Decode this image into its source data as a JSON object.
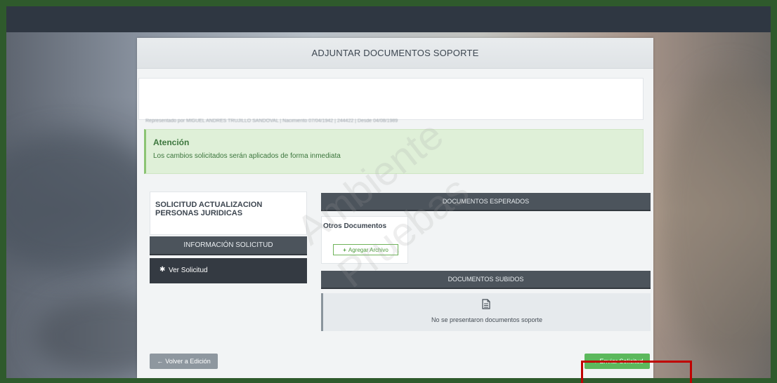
{
  "panel": {
    "title": "ADJUNTAR DOCUMENTOS SOPORTE"
  },
  "applicant": {
    "partial_info": "Representado por MIGUEL ANDRES TRUJILLO SANDOVAL | Nacimiento 07/04/1942 | 244422 | Desde 04/08/1989"
  },
  "alert": {
    "title": "Atención",
    "text": "Los cambios solicitados serán aplicados de forma inmediata"
  },
  "request": {
    "title": "SOLICITUD ACTUALIZACION PERSONAS JURIDICAS",
    "info_header": "INFORMACIÓN SOLICITUD",
    "view_label": "Ver Solicitud",
    "view_icon": "gear-icon"
  },
  "documents": {
    "expected_header": "DOCUMENTOS ESPERADOS",
    "other_docs_title": "Otros Documentos",
    "add_file_label": "Agregar Archivo",
    "uploaded_header": "DOCUMENTOS SUBIDOS",
    "no_docs_text": "No se presentaron documentos soporte",
    "no_docs_icon": "document-icon"
  },
  "actions": {
    "back_label": "Volver a Edición",
    "send_label": "Enviar Solicitud"
  },
  "watermark": {
    "line1": "Ambiente",
    "line2": "Pruebas"
  },
  "colors": {
    "outer_border": "#2f5a2c",
    "topbar": "#2f3742",
    "send_button": "#5cb85c",
    "alert_bg": "#dff0d8",
    "highlight": "#c00000"
  }
}
